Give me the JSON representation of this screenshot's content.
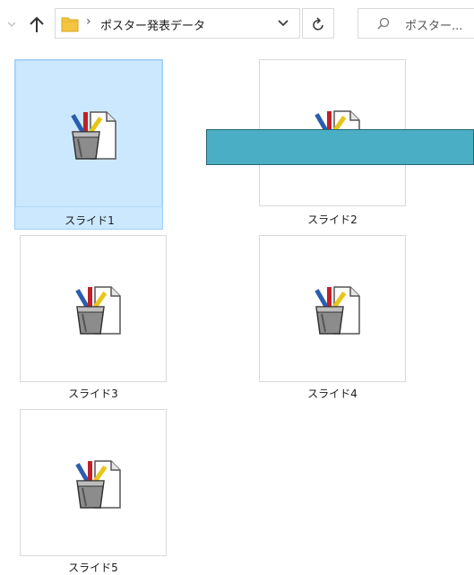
{
  "address_bar": {
    "path_folder": "ポスター発表データ",
    "search_placeholder": "ポスター..."
  },
  "files": [
    {
      "label": "スライド1",
      "selected": true
    },
    {
      "label": "スライド2",
      "selected": false
    },
    {
      "label": "スライド3",
      "selected": false
    },
    {
      "label": "スライド4",
      "selected": false
    },
    {
      "label": "スライド5",
      "selected": false
    }
  ],
  "icons": {
    "file_icon": "powerpoint-file-icon",
    "folder": "folder-icon",
    "up": "up-arrow-icon",
    "refresh": "refresh-icon",
    "search": "search-icon"
  },
  "colors": {
    "selection": "#cce8ff",
    "overlay_bar": "#4aafc4"
  }
}
